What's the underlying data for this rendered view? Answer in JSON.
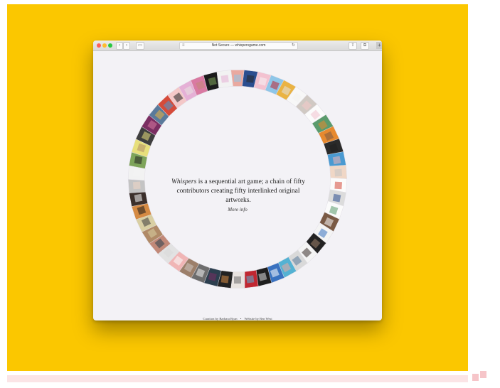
{
  "browser": {
    "security_label": "Not Secure",
    "separator": "—",
    "host": "whispersgame.com",
    "back_icon": "chevron-left-icon",
    "forward_icon": "chevron-right-icon",
    "sidebar_icon": "sidebar-icon",
    "share_icon": "share-icon",
    "tabs_icon": "tabs-icon",
    "new_tab_icon": "plus-icon"
  },
  "page": {
    "title_italic": "Whispers",
    "intro_text": " is a sequential art game; a chain of fifty contributors creating fifty interlinked original artworks.",
    "more_link": "More info",
    "credit_curation": "Curation by Barbara Ryan",
    "credit_bullet": "•",
    "credit_website": "Website by Ben West"
  },
  "artworks": {
    "count": 50,
    "colors": [
      "#e9a9a0",
      "#2b4e8f",
      "#f3c2d0",
      "#8ec6e8",
      "#eab343",
      "#f7f7f7",
      "#d0c9c3",
      "#fbfbfb",
      "#5a9b6c",
      "#e7892f",
      "#2a2a2a",
      "#4a9ad1",
      "#f0d7c6",
      "#fbfbfb",
      "#dcdcdc",
      "#fbfbfb",
      "#7a5a45",
      "#f4f4f4",
      "#222222",
      "#f4f4f4",
      "#d9d9d9",
      "#54b2d3",
      "#3972c0",
      "#1f1f1f",
      "#c02731",
      "#e8e3e0",
      "#222222",
      "#2c3f4f",
      "#6d6d6d",
      "#9c7f6a",
      "#f0b5b5",
      "#e2e2e2",
      "#c28978",
      "#b08a67",
      "#d9cfa3",
      "#d58a43",
      "#3b2f2b",
      "#c4c4c4",
      "#f2f2f2",
      "#7ea45a",
      "#e7df7b",
      "#3e3e3e",
      "#7a2e62",
      "#5a7a9b",
      "#d64b3a",
      "#f4c8c8",
      "#e5b0d6",
      "#d97aa2",
      "#1b1b1b",
      "#f2f2f2"
    ]
  }
}
